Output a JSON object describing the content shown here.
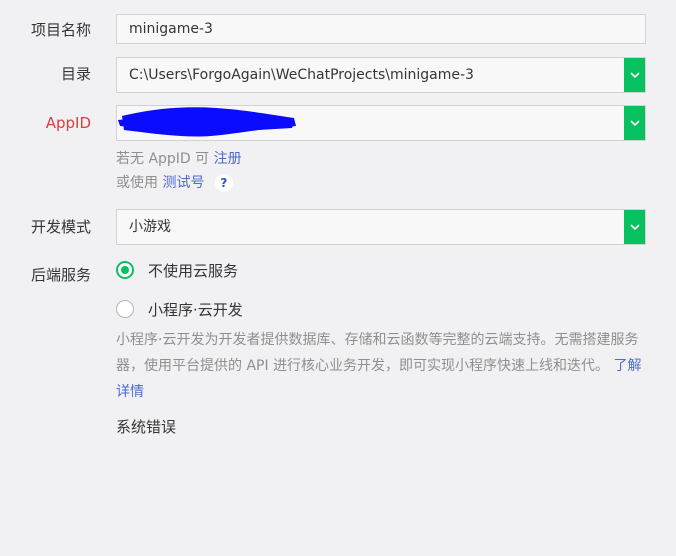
{
  "form": {
    "project_name": {
      "label": "项目名称",
      "value": "minigame-3"
    },
    "directory": {
      "label": "目录",
      "value": "C:\\Users\\ForgoAgain\\WeChatProjects\\minigame-3"
    },
    "appid": {
      "label": "AppID",
      "value": "",
      "hint_prefix": "若无 AppID 可",
      "register_link": "注册",
      "test_prefix": "或使用",
      "test_link": "测试号",
      "help_icon_text": "?"
    },
    "dev_mode": {
      "label": "开发模式",
      "value": "小游戏"
    },
    "backend": {
      "label": "后端服务",
      "options": [
        {
          "label": "不使用云服务",
          "selected": true
        },
        {
          "label": "小程序·云开发",
          "selected": false
        }
      ],
      "description": "小程序·云开发为开发者提供数据库、存储和云函数等完整的云端支持。无需搭建服务器，使用平台提供的 API 进行核心业务开发，即可实现小程序快速上线和迭代。",
      "learn_more": "了解详情"
    },
    "error_text": "系统错误"
  },
  "colors": {
    "accent": "#07c160",
    "error": "#d0423c",
    "link": "#4d6bcc",
    "redaction": "#0b0bff"
  }
}
